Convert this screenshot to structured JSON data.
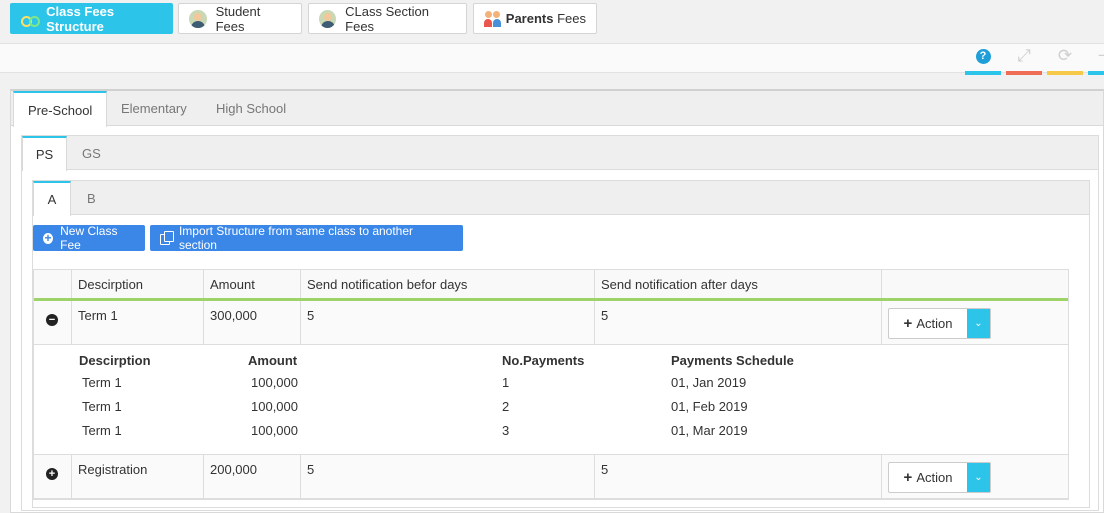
{
  "module_tabs": [
    {
      "label": "Class Fees Structure",
      "icon": "glasses-icon",
      "active": true
    },
    {
      "label": "Student Fees",
      "icon": "student-icon",
      "active": false
    },
    {
      "label": "CLass Section Fees",
      "icon": "student-icon",
      "active": false
    },
    {
      "label_bold": "Parents",
      "label": " Fees",
      "icon": "parents-icon",
      "active": false
    }
  ],
  "toolbar": {
    "help": "?",
    "colors": [
      "#2cc4e8",
      "#ef6c57",
      "#f7c948",
      "#2cc4e8"
    ]
  },
  "level_tabs": [
    "Pre-School",
    "Elementary",
    "High School"
  ],
  "class_tabs": [
    "PS",
    "GS"
  ],
  "section_tabs": [
    "A",
    "B"
  ],
  "buttons": {
    "new_class_fee": "New Class Fee",
    "import_structure": "Import Structure from same class to another section"
  },
  "table": {
    "headers": [
      "Descirption",
      "Amount",
      "Send notification befor days",
      "Send notification after days"
    ],
    "rows": [
      {
        "toggle": "−",
        "description": "Term 1",
        "amount": "300,000",
        "before": "5",
        "after": "5",
        "action": "Action"
      },
      {
        "toggle": "+",
        "description": "Registration",
        "amount": "200,000",
        "before": "5",
        "after": "5",
        "action": "Action"
      }
    ],
    "sub_headers": [
      "Descirption",
      "Amount",
      "No.Payments",
      "Payments Schedule"
    ],
    "sub_rows": [
      {
        "description": "Term 1",
        "amount": "100,000",
        "payments": "1",
        "schedule": "01, Jan 2019"
      },
      {
        "description": "Term 1",
        "amount": "100,000",
        "payments": "2",
        "schedule": "01, Feb 2019"
      },
      {
        "description": "Term 1",
        "amount": "100,000",
        "payments": "3",
        "schedule": "01, Mar 2019"
      }
    ]
  }
}
